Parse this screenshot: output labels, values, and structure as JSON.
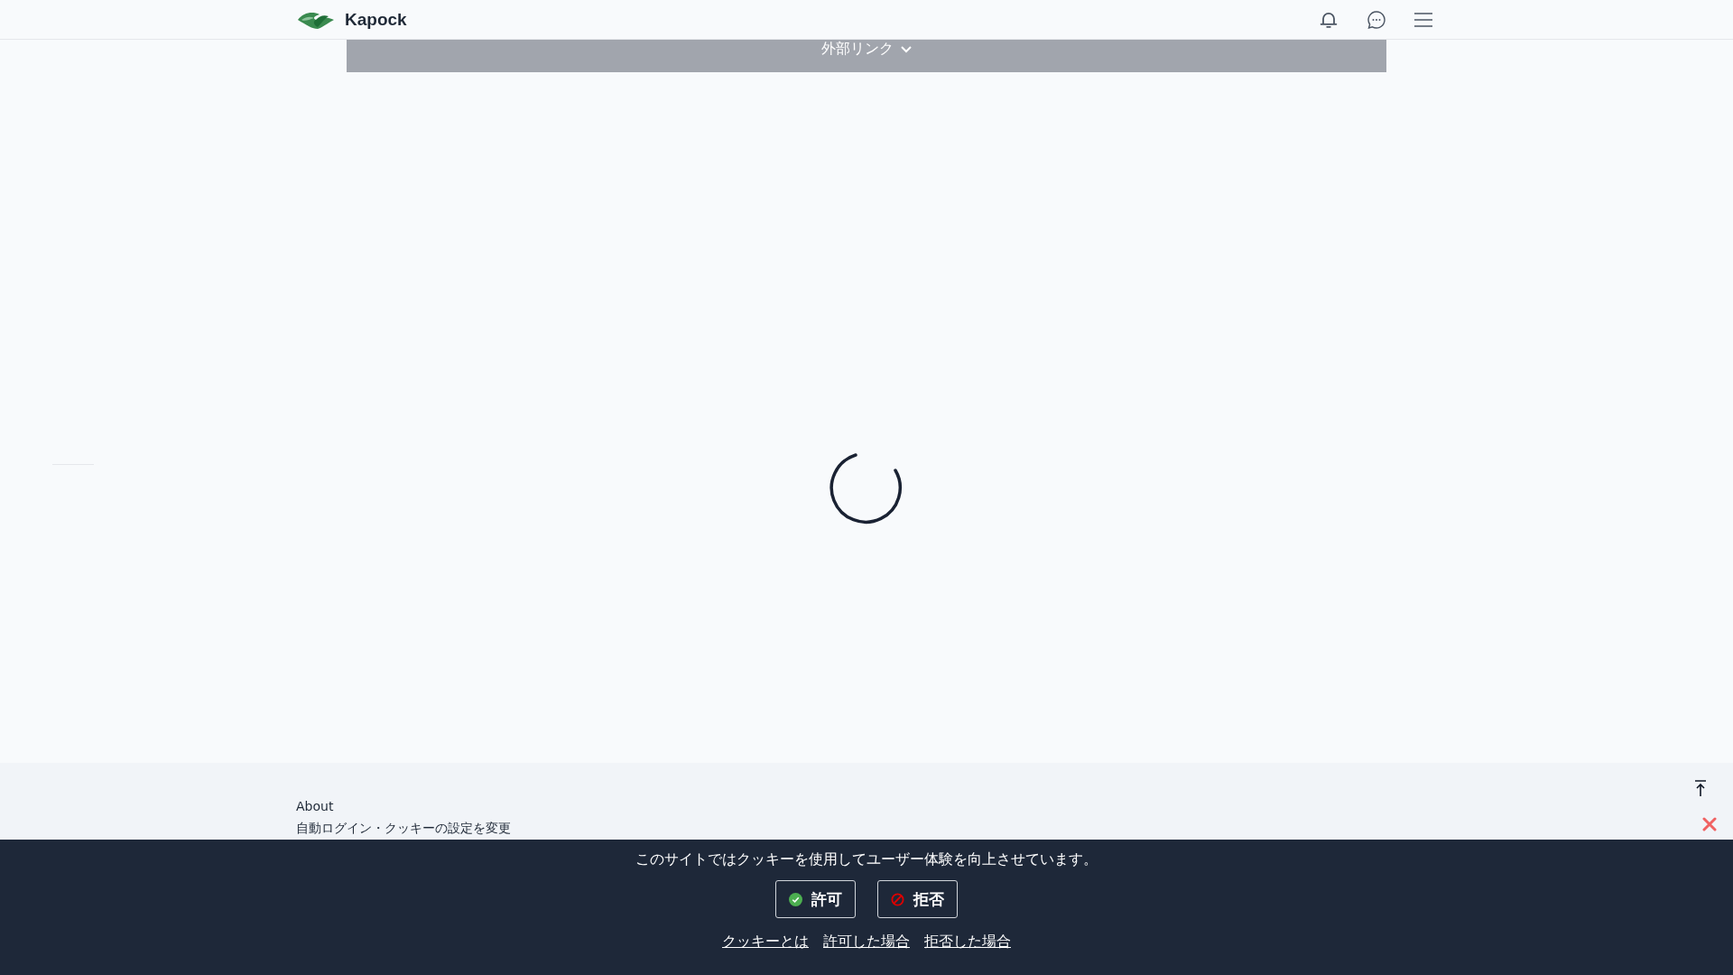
{
  "header": {
    "logo_text": "Kapock"
  },
  "external_link_bar": {
    "label": "外部リンク"
  },
  "footer": {
    "links": [
      "About",
      "自動ログイン・クッキーの設定を変更"
    ]
  },
  "cookie_banner": {
    "message": "このサイトではクッキーを使用してユーザー体験を向上させています。",
    "buttons": [
      {
        "label": "許可",
        "kind": "allow"
      },
      {
        "label": "拒否",
        "kind": "deny"
      }
    ],
    "links": [
      "クッキーとは",
      "許可した場合",
      "拒否した場合"
    ]
  }
}
